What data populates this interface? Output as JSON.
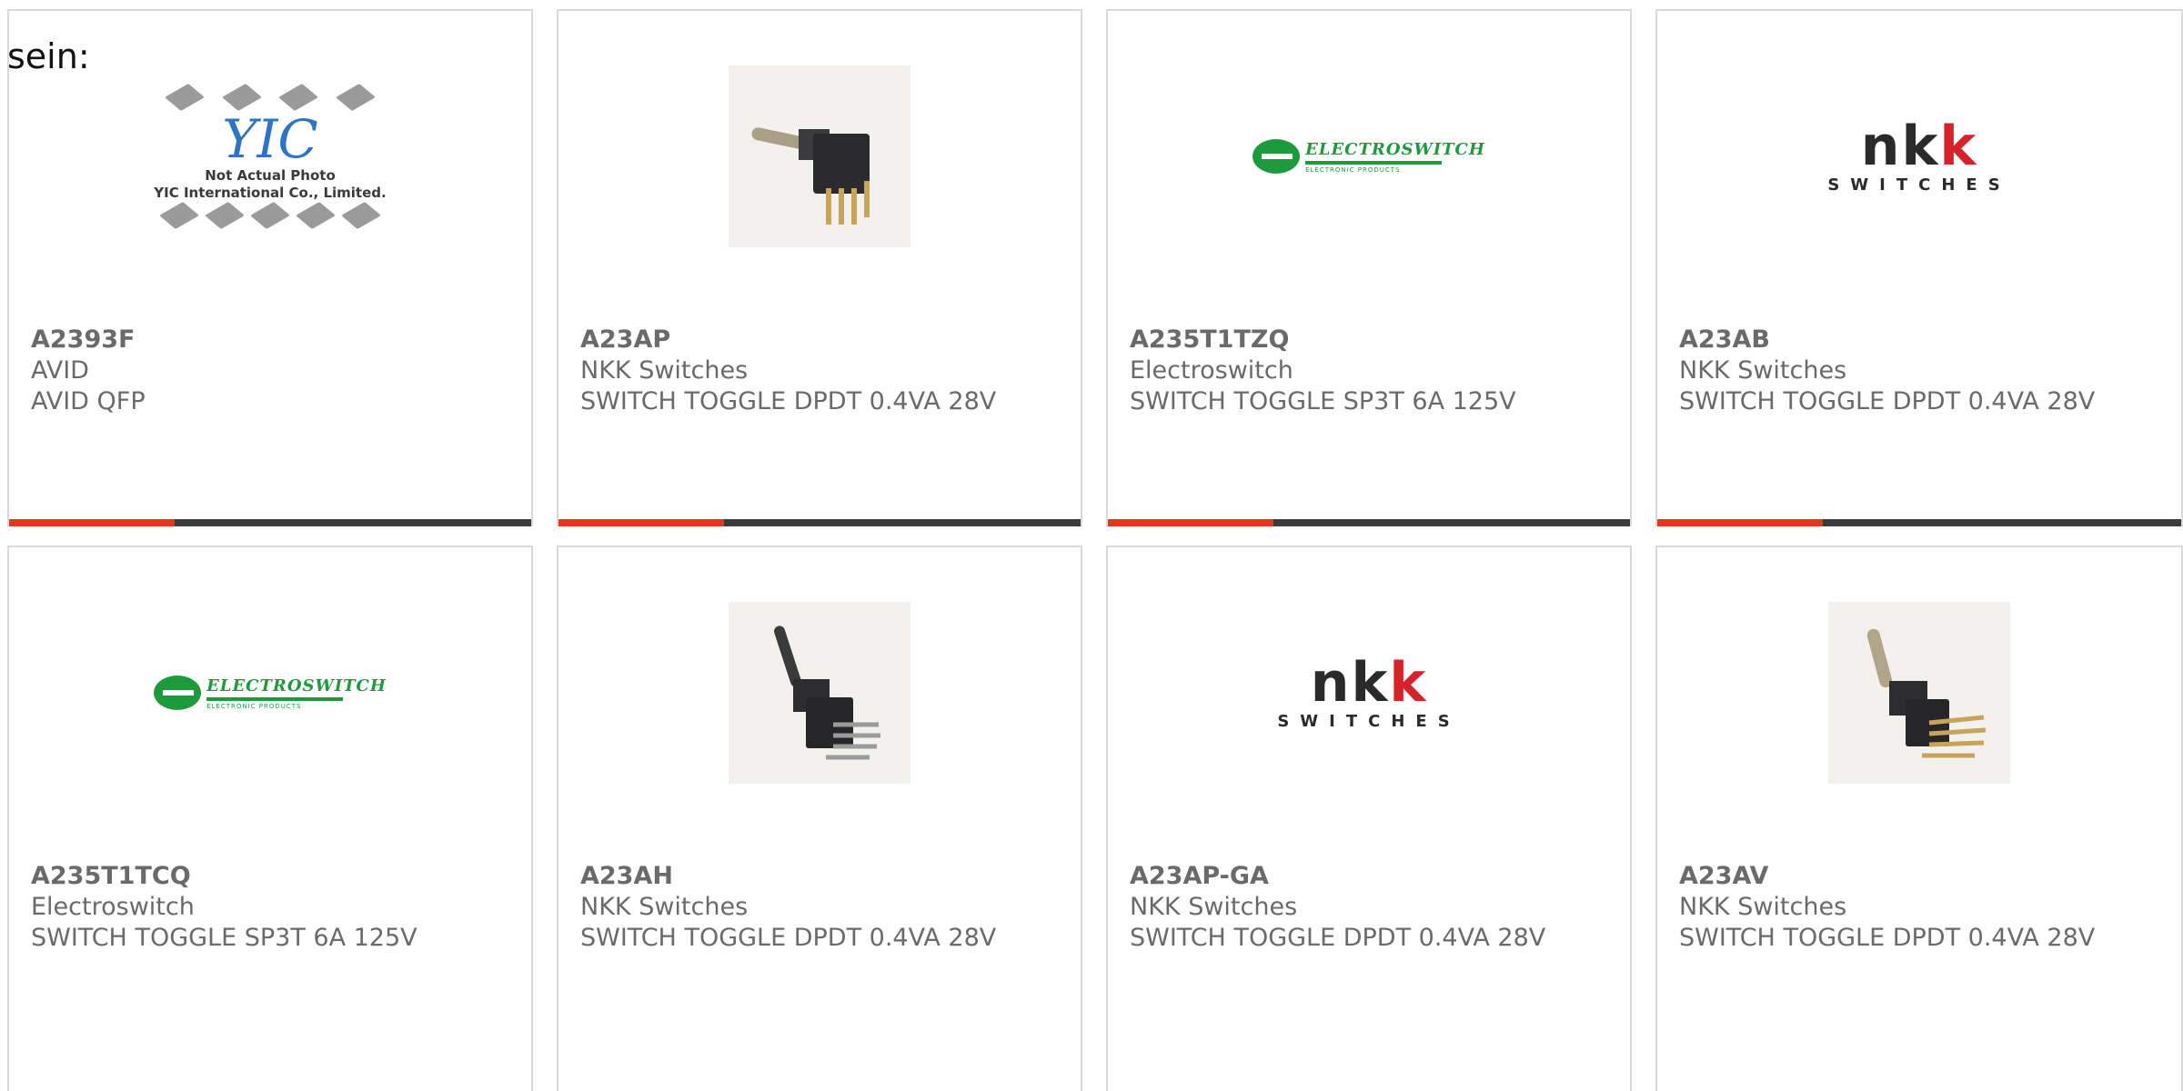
{
  "lead_text": "sein:",
  "thumb_note": {
    "line1": "Not Actual Photo",
    "line2": "YIC International Co., Limited.",
    "mark": "YIC"
  },
  "electroswitch_logo": {
    "title": "ELECTROSWITCH",
    "sub": "ELECTRONIC PRODUCTS"
  },
  "nkk_logo": {
    "word": "NKK",
    "sub": "SWITCHES"
  },
  "colors": {
    "accent": "#e0391b",
    "bar": "#3b3b3b",
    "border": "#dadada",
    "text": "#6a6a6a"
  },
  "products": [
    {
      "part": "A2393F",
      "maker": "AVID",
      "desc": "AVID QFP",
      "image": "yic-placeholder"
    },
    {
      "part": "A23AP",
      "maker": "NKK Switches",
      "desc": "SWITCH TOGGLE DPDT 0.4VA 28V",
      "image": "toggle-switch-photo"
    },
    {
      "part": "A235T1TZQ",
      "maker": "Electroswitch",
      "desc": "SWITCH TOGGLE SP3T 6A 125V",
      "image": "electroswitch-logo"
    },
    {
      "part": "A23AB",
      "maker": "NKK Switches",
      "desc": "SWITCH TOGGLE DPDT 0.4VA 28V",
      "image": "nkk-logo"
    },
    {
      "part": "A235T1TCQ",
      "maker": "Electroswitch",
      "desc": "SWITCH TOGGLE SP3T 6A 125V",
      "image": "electroswitch-logo"
    },
    {
      "part": "A23AH",
      "maker": "NKK Switches",
      "desc": "SWITCH TOGGLE DPDT 0.4VA 28V",
      "image": "toggle-switch-photo"
    },
    {
      "part": "A23AP-GA",
      "maker": "NKK Switches",
      "desc": "SWITCH TOGGLE DPDT 0.4VA 28V",
      "image": "nkk-logo"
    },
    {
      "part": "A23AV",
      "maker": "NKK Switches",
      "desc": "SWITCH TOGGLE DPDT 0.4VA 28V",
      "image": "toggle-switch-photo"
    }
  ]
}
